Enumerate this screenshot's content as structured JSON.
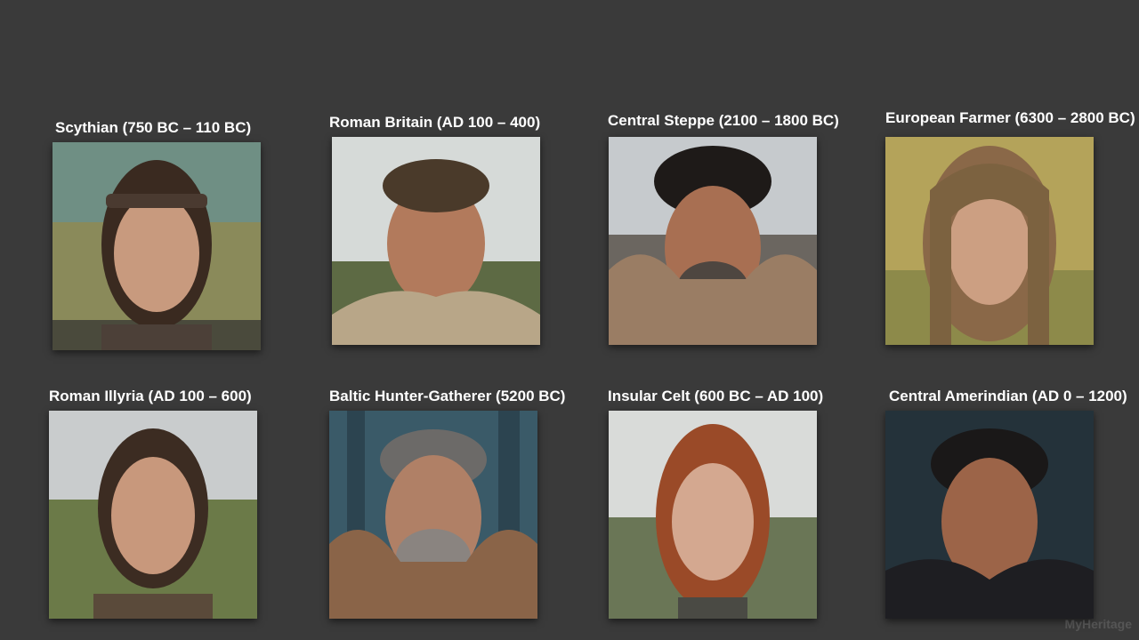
{
  "portraits": [
    {
      "title": "Scythian (750 BC – 110 BC)"
    },
    {
      "title": "Roman Britain (AD 100 – 400)"
    },
    {
      "title": "Central Steppe (2100 – 1800 BC)"
    },
    {
      "title": "European Farmer (6300 – 2800 BC)"
    },
    {
      "title": "Roman Illyria (AD 100 – 600)"
    },
    {
      "title": "Baltic Hunter-Gatherer (5200 BC)"
    },
    {
      "title": "Insular Celt (600 BC – AD 100)"
    },
    {
      "title": "Central Amerindian (AD 0 – 1200)"
    }
  ],
  "watermark": "MyHeritage",
  "colors": {
    "background": "#3a3a3a",
    "title_text": "#ffffff"
  }
}
